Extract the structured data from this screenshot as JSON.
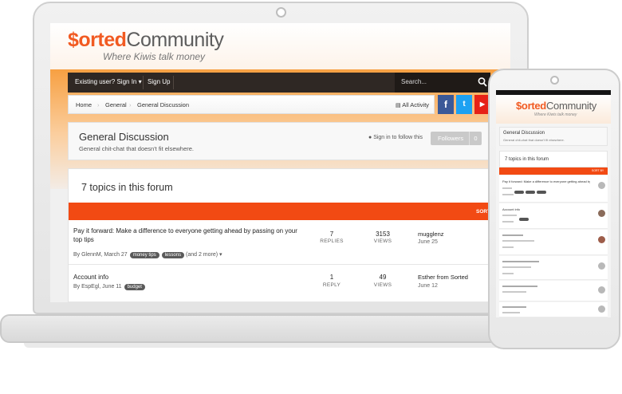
{
  "site": {
    "logo_prefix": "$orted",
    "logo_suffix": "Community",
    "tagline": "Where Kiwis talk money"
  },
  "nav": {
    "signin": "Existing user? Sign In",
    "signup": "Sign Up",
    "search_placeholder": "Search..."
  },
  "breadcrumb": [
    "Home",
    "General",
    "General Discussion"
  ],
  "all_activity": "All Activity",
  "social": {
    "facebook": "f",
    "twitter": "t",
    "youtube": "▶"
  },
  "forum": {
    "title": "General Discussion",
    "description": "General chit-chat that doesn't fit elsewhere.",
    "sign_in_to_follow": "Sign in to follow this",
    "followers_label": "Followers",
    "followers_count": "0",
    "topics_heading": "7 topics in this forum",
    "sort_by": "SORT BY"
  },
  "topics": [
    {
      "title": "Pay it forward: Make a difference to everyone getting ahead by passing on your top tips",
      "author_date": "By GlennM, March 27",
      "tags": [
        "money tips",
        "lessons"
      ],
      "more": "(and 2 more)",
      "replies": "7",
      "replies_label": "REPLIES",
      "views": "3153",
      "views_label": "VIEWS",
      "last_user": "mugglenz",
      "last_date": "June 25"
    },
    {
      "title": "Account info",
      "author_date": "By EspEgl, June 11",
      "tags": [
        "budget"
      ],
      "more": "",
      "replies": "1",
      "replies_label": "REPLY",
      "views": "49",
      "views_label": "VIEWS",
      "last_user": "Esther from Sorted",
      "last_date": "June 12"
    }
  ],
  "colors": {
    "brand_orange": "#f15a22",
    "sort_bar": "#f24a13",
    "nav_dark": "#2f2824",
    "facebook": "#3b5998",
    "twitter": "#1da1f2",
    "youtube": "#e62117"
  },
  "icons": {
    "search": "magnifier",
    "rss": "rss-feed",
    "info": "info-circle",
    "caret": "caret-down"
  }
}
